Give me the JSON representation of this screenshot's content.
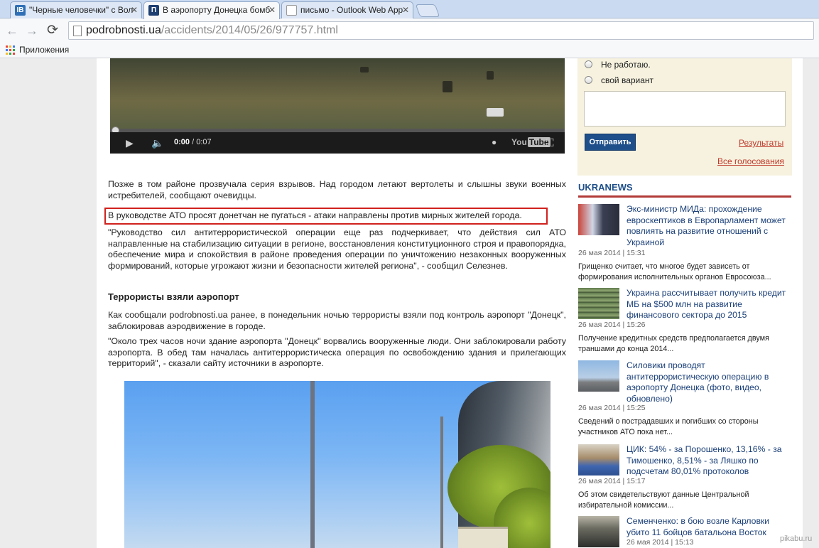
{
  "browser": {
    "tabs": [
      {
        "label": "\"Черные человечки\" с Вол",
        "favicon": "IB",
        "active": false
      },
      {
        "label": "В аэропорту Донецка бомб",
        "favicon": "П",
        "active": true
      },
      {
        "label": "письмо - Outlook Web App",
        "favicon": "",
        "active": false
      }
    ],
    "url_host": "podrobnosti.ua",
    "url_path": "/accidents/2014/05/26/977757.html",
    "bookmarks_apps": "Приложения"
  },
  "video": {
    "time_current": "0:00",
    "time_total": "/ 0:07",
    "youtube_label": "You",
    "youtube_tube": "Tube",
    "progress": 0.0
  },
  "article": {
    "para1": "Позже в том районе прозвучала серия взрывов. Над городом летают вертолеты и слышны звуки военных истребителей, сообщают очевидцы.",
    "highlight": "В руководстве АТО просят донетчан не пугаться - атаки направлены против мирных жителей города.",
    "para2": "\"Руководство сил антитеррористической операции еще раз подчеркивает, что действия сил АТО направленные на стабилизацию ситуации в регионе, восстановления конституционного строя и правопорядка, обеспечение мира и спокойствия в районе проведения операции по уничтожению незаконных вооруженных формирований, которые угрожают жизни и безопасности жителей региона\", - сообщил Селезнев.",
    "subhead": "Террористы взяли аэропорт",
    "para3": "Как сообщали podrobnosti.ua ранее, в понедельник ночью террористы взяли под контроль аэропорт \"Донецк\", заблокировав аэродвижение в городе.",
    "para4": "\"Около трех часов ночи здание аэропорта \"Донецк\" ворвались вооруженные люди. Они заблокировали работу аэропорта. В обед там началась антитеррористическа операция по освобождению здания и прилегающих территорий\", - сказали сайту источники в аэропорте."
  },
  "poll": {
    "option1": "Не работаю.",
    "option2": "свой вариант",
    "submit_label": "Отправить",
    "results_link": "Результаты",
    "all_polls_link": "Все голосования"
  },
  "ukranews": {
    "heading": "UKRANEWS",
    "items": [
      {
        "title": "Экс-министр МИДа: прохождение евроскептиков в Европарламент может повлиять на развитие отношений с Украиной",
        "date": "26 мая 2014 | 15:31",
        "summary": "Грищенко считает, что многое будет зависеть от формирования исполнительных органов Евросоюза..."
      },
      {
        "title": "Украина рассчитывает получить кредит МБ на $500 млн на развитие финансового сектора до 2015",
        "date": "26 мая 2014 | 15:26",
        "summary": "Получение кредитных средств предполагается двумя траншами до конца 2014..."
      },
      {
        "title": "Силовики проводят антитеррористическую операцию в аэропорту Донецка (фото, видео, обновлено)",
        "date": "26 мая 2014 | 15:25",
        "summary": "Сведений о пострадавших и погибших со стороны участников АТО пока нет..."
      },
      {
        "title": "ЦИК: 54% - за Порошенко, 13,16% - за Тимошенко, 8,51% - за Ляшко по подсчетам 80,01% протоколов",
        "date": "26 мая 2014 | 15:17",
        "summary": "Об этом свидетельствуют данные Центральной избирательной комиссии..."
      },
      {
        "title": "Семенченко: в бою возле Карловки убито 11 бойцов батальона Восток",
        "date": "26 мая 2014 | 15:13",
        "summary": ""
      }
    ]
  },
  "watermark": "pikabu.ru",
  "colors": {
    "tabstrip": "#c9daf1",
    "accent_blue": "#1e4f8a",
    "link_red": "#c0392b",
    "highlight_border": "#d1221e",
    "poll_bg": "#f6f2df"
  }
}
